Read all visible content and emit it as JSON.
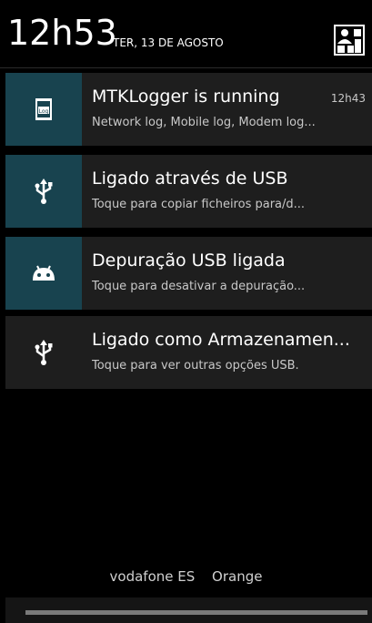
{
  "status": {
    "time": "12h53",
    "date": "TER, 13 DE AGOSTO",
    "settings_icon": "quick-settings-icon"
  },
  "notifications": [
    {
      "icon": "log-file-icon",
      "title": "MTKLogger is running",
      "subtitle": "Network log, Mobile log, Modem log...",
      "time": "12h43",
      "highlight": true
    },
    {
      "icon": "usb-icon",
      "title": "Ligado através de USB",
      "subtitle": "Toque para copiar ficheiros para/d...",
      "highlight": true
    },
    {
      "icon": "android-icon",
      "title": "Depuração USB ligada",
      "subtitle": "Toque para desativar a depuração...",
      "highlight": true
    },
    {
      "icon": "usb-icon",
      "title": "Ligado como Armazenamen...",
      "subtitle": "Toque para ver outras opções USB.",
      "highlight": false
    }
  ],
  "carriers": [
    "vodafone ES",
    "Orange"
  ],
  "colors": {
    "background": "#000000",
    "notification_bg": "#1e1e1e",
    "icon_highlight_bg": "#18434f",
    "handle": "#7a7a7a"
  }
}
